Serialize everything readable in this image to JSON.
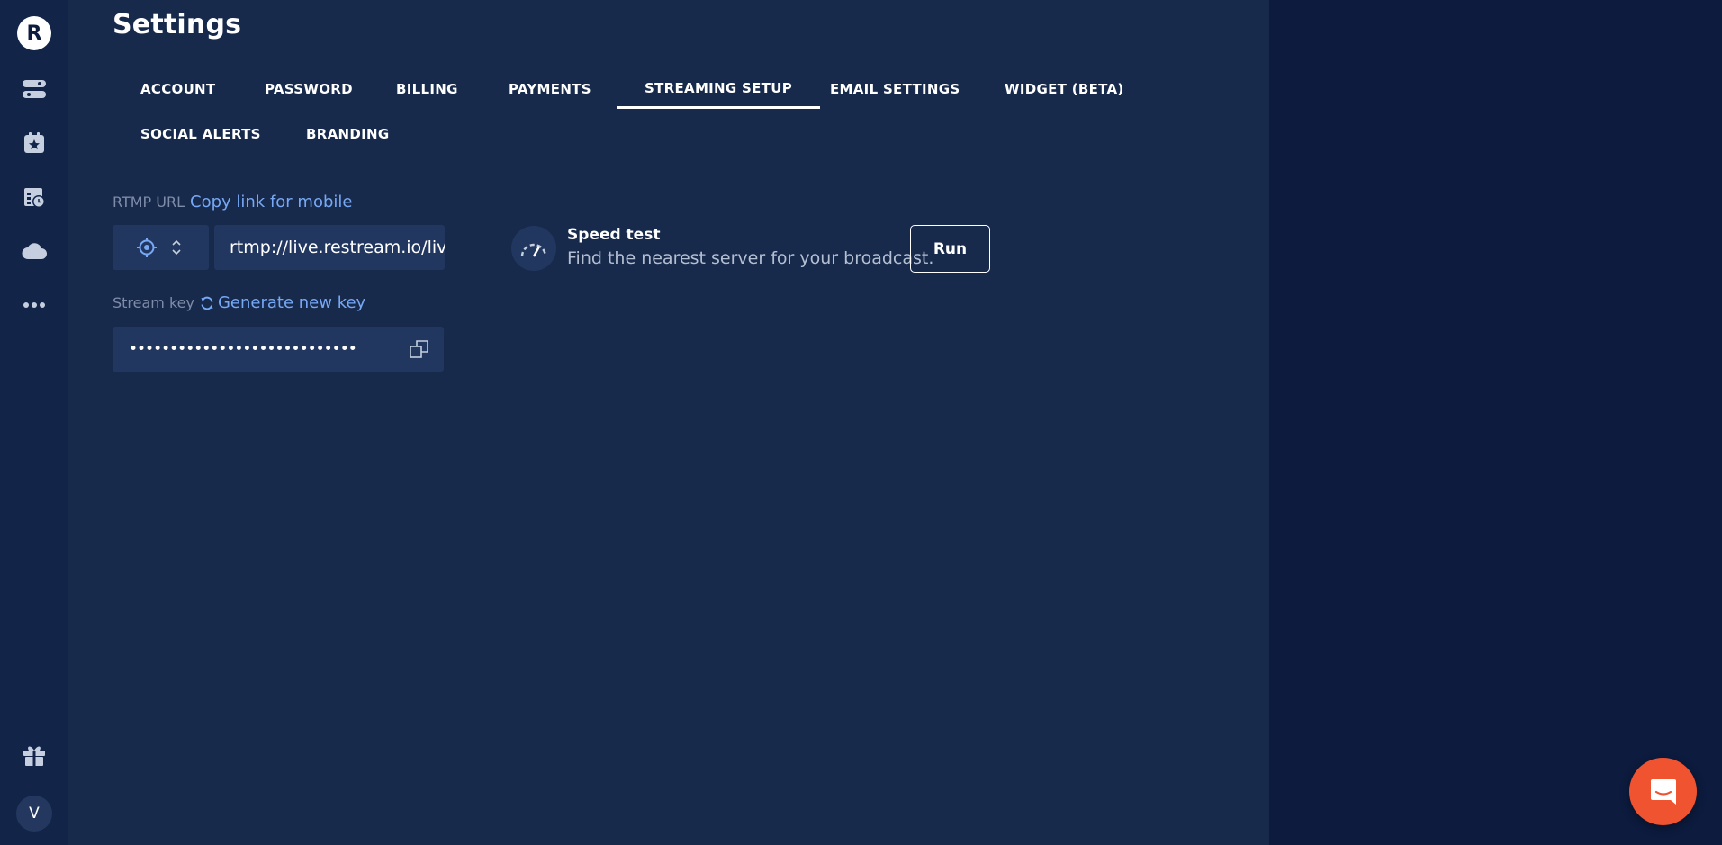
{
  "rail": {
    "logo_letter": "R",
    "items": [
      "stream-icon",
      "calendar-star-icon",
      "calendar-clock-icon",
      "cloud-icon",
      "more-icon"
    ],
    "bottom_item": "gift-icon",
    "avatar_letter": "V"
  },
  "page": {
    "title": "Settings"
  },
  "tabs": [
    {
      "label": "ACCOUNT",
      "active": false
    },
    {
      "label": "PASSWORD",
      "active": false
    },
    {
      "label": "BILLING",
      "active": false
    },
    {
      "label": "PAYMENTS",
      "active": false
    },
    {
      "label": "STREAMING SETUP",
      "active": true
    },
    {
      "label": "EMAIL SETTINGS",
      "active": false
    },
    {
      "label": "WIDGET (BETA)",
      "active": false
    },
    {
      "label": "SOCIAL ALERTS",
      "active": false
    },
    {
      "label": "BRANDING",
      "active": false
    }
  ],
  "rtmp": {
    "label": "RTMP URL",
    "link": "Copy link for mobile",
    "value": "rtmp://live.restream.io/live"
  },
  "stream_key": {
    "label": "Stream key",
    "link": "Generate new key",
    "masked_value": "••••••••••••••••••••••••••••"
  },
  "speed_test": {
    "title": "Speed test",
    "subtitle": "Find the nearest server for your broadcast.",
    "button": "Run"
  },
  "colors": {
    "background": "#0c1b3e",
    "rail": "#122548",
    "panel": "#172a4c",
    "field": "#223760",
    "link": "#77a8f5",
    "chat_accent": "#f0532f"
  }
}
